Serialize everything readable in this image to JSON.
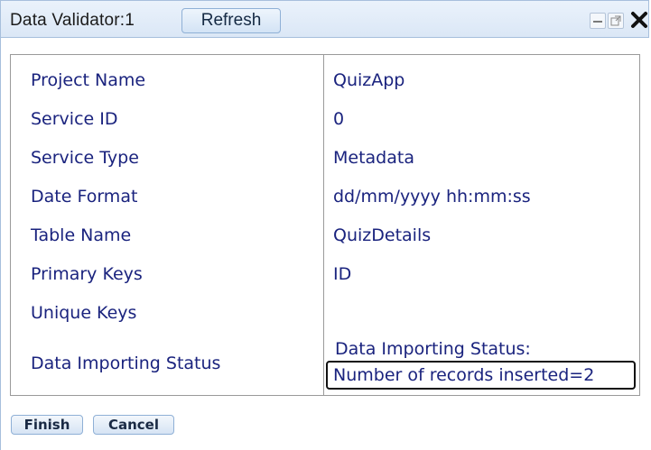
{
  "window": {
    "title": "Data Validator:1",
    "refresh_label": "Refresh"
  },
  "table": {
    "rows": [
      {
        "label": "Project Name",
        "value": "QuizApp"
      },
      {
        "label": "Service ID",
        "value": "0"
      },
      {
        "label": "Service Type",
        "value": "Metadata"
      },
      {
        "label": "Date Format",
        "value": "dd/mm/yyyy hh:mm:ss"
      },
      {
        "label": "Table Name",
        "value": "QuizDetails"
      },
      {
        "label": "Primary Keys",
        "value": "ID"
      },
      {
        "label": "Unique Keys",
        "value": ""
      },
      {
        "label": "Data Importing Status",
        "value": ""
      }
    ],
    "status_line1": "Data Importing Status:",
    "status_line2": "Number of records inserted=2"
  },
  "actions": {
    "finish_label": "Finish",
    "cancel_label": "Cancel"
  },
  "icons": {
    "minimize": "minimize-icon",
    "popout": "popout-icon",
    "close": "close-icon"
  },
  "colors": {
    "label_text": "#1a237e",
    "titlebar_bg": "#dbe7f6",
    "button_border": "#8fb0d6"
  }
}
